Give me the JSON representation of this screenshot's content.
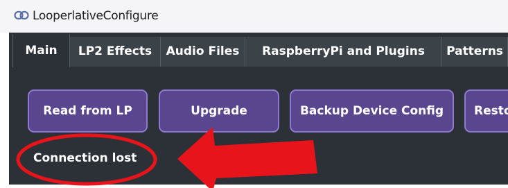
{
  "window": {
    "title": "LooperlativeConfigure",
    "icon": "link-icon"
  },
  "tabs": [
    {
      "label": "Main",
      "active": true
    },
    {
      "label": "LP2 Effects",
      "active": false
    },
    {
      "label": "Audio Files",
      "active": false
    },
    {
      "label": "RaspberryPi and Plugins",
      "active": false
    },
    {
      "label": "Patterns",
      "active": false
    }
  ],
  "buttons": [
    {
      "label": "Read from LP"
    },
    {
      "label": "Upgrade"
    },
    {
      "label": "Backup Device Config"
    },
    {
      "label": "Resto"
    }
  ],
  "status": {
    "text": "Connection lost"
  },
  "annotation": {
    "color": "#e8141c",
    "shapes": [
      "red-ellipse",
      "red-arrow"
    ]
  },
  "theme": {
    "background": "#2b3136",
    "button_fill": "#5a468f",
    "button_border": "#8f7ad1",
    "tab_fill": "#3b4248"
  }
}
